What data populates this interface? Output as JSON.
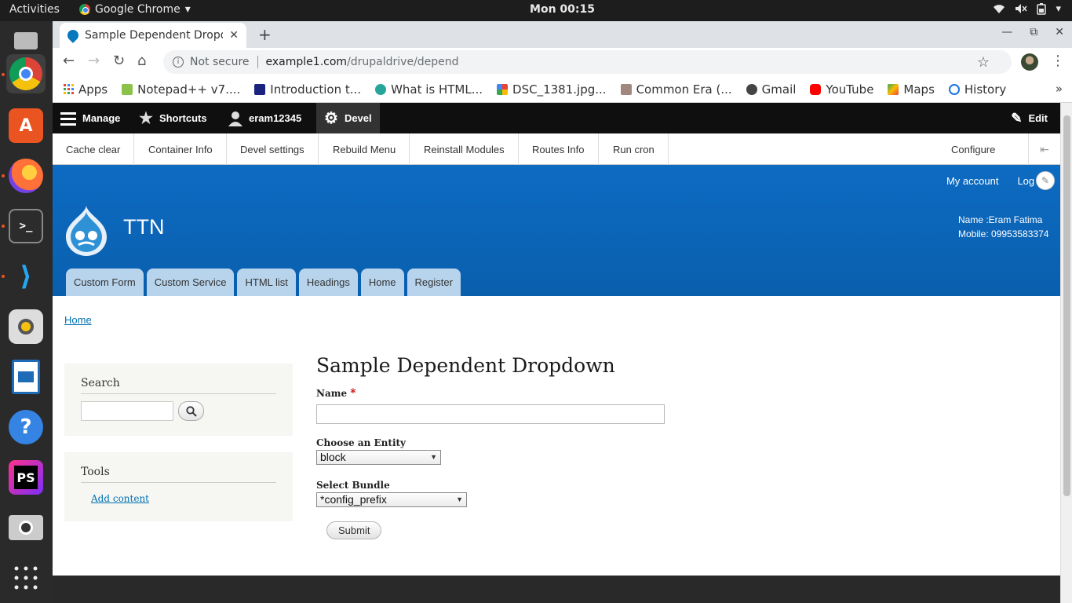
{
  "os": {
    "activities": "Activities",
    "app_name": "Google Chrome",
    "clock": "Mon 00:15"
  },
  "browser": {
    "tab_title": "Sample Dependent Dropdo",
    "security": "Not secure",
    "url_host": "example1.com",
    "url_path": "/drupaldrive/depend",
    "bookmarks": [
      {
        "label": "Apps",
        "color": "#4285f4"
      },
      {
        "label": "Notepad++ v7....",
        "color": "#8bc34a"
      },
      {
        "label": "Introduction t...",
        "color": "#1a237e"
      },
      {
        "label": "What is HTML...",
        "color": "#26a69a"
      },
      {
        "label": "DSC_1381.jpg...",
        "color": "#f4b400"
      },
      {
        "label": "Common Era (...",
        "color": "#a1887f"
      },
      {
        "label": "Gmail",
        "color": "#444444"
      },
      {
        "label": "YouTube",
        "color": "#ff0000"
      },
      {
        "label": "Maps",
        "color": "#34a853"
      },
      {
        "label": "History",
        "color": "#1a73e8"
      }
    ],
    "more": "»"
  },
  "admin": {
    "manage": "Manage",
    "shortcuts": "Shortcuts",
    "user": "eram12345",
    "devel": "Devel",
    "edit": "Edit"
  },
  "tray": {
    "items": [
      "Cache clear",
      "Container Info",
      "Devel settings",
      "Rebuild Menu",
      "Reinstall Modules",
      "Routes Info",
      "Run cron"
    ],
    "configure": "Configure"
  },
  "header": {
    "my_account": "My account",
    "log_out": "Log o",
    "site_name": "TTN",
    "name_line": "Name :Eram Fatima",
    "mobile_line": "Mobile: 09953583374",
    "tabs": [
      "Custom Form",
      "Custom Service",
      "HTML list",
      "Headings",
      "Home",
      "Register"
    ]
  },
  "breadcrumb": "Home",
  "sidebar": {
    "search_title": "Search",
    "tools_title": "Tools",
    "add_content": "Add content"
  },
  "form": {
    "title": "Sample Dependent Dropdown",
    "name_label": "Name",
    "required_mark": "*",
    "entity_label": "Choose an Entity",
    "entity_value": "block",
    "bundle_label": "Select Bundle",
    "bundle_value": "*config_prefix",
    "submit": "Submit"
  }
}
